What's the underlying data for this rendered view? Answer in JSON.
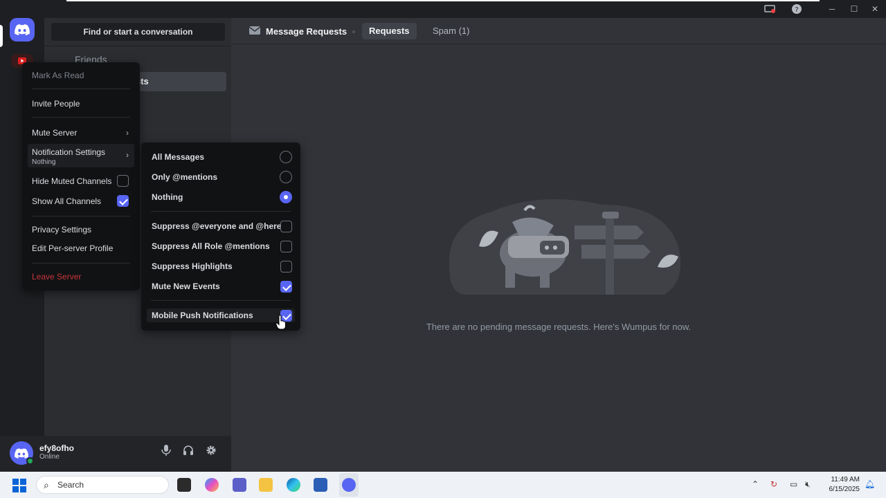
{
  "sidebar": {
    "search_label": "Find or start a conversation",
    "friends_label": "Friends",
    "active_fragment": "sts"
  },
  "user": {
    "name": "efy8ofho",
    "status": "Online"
  },
  "header": {
    "title": "Message Requests",
    "tabs": [
      {
        "label": "Requests",
        "active": true
      },
      {
        "label": "Spam (1)",
        "active": false
      }
    ]
  },
  "main": {
    "empty_text": "There are no pending message requests. Here's Wumpus for now."
  },
  "context_menu": {
    "mark_as_read": "Mark As Read",
    "invite_people": "Invite People",
    "mute_server": "Mute Server",
    "notification_settings": "Notification Settings",
    "notification_value": "Nothing",
    "hide_muted_channels": "Hide Muted Channels",
    "hide_muted_checked": false,
    "show_all_channels": "Show All Channels",
    "show_all_checked": true,
    "privacy_settings": "Privacy Settings",
    "edit_profile": "Edit Per-server Profile",
    "leave_server": "Leave Server"
  },
  "notification_submenu": {
    "all_messages": "All Messages",
    "only_mentions": "Only @mentions",
    "nothing": "Nothing",
    "selected": "Nothing",
    "suppress_everyone": "Suppress @everyone and @here",
    "suppress_everyone_checked": false,
    "suppress_roles": "Suppress All Role @mentions",
    "suppress_roles_checked": false,
    "suppress_highlights": "Suppress Highlights",
    "suppress_highlights_checked": false,
    "mute_new_events": "Mute New Events",
    "mute_new_events_checked": true,
    "mobile_push": "Mobile Push Notifications",
    "mobile_push_checked": true
  },
  "taskbar": {
    "search_label": "Search",
    "time": "11:49 AM",
    "date": "6/15/2025"
  },
  "colors": {
    "blurple": "#5865f2",
    "online": "#23a55a",
    "danger": "#f23f43"
  }
}
